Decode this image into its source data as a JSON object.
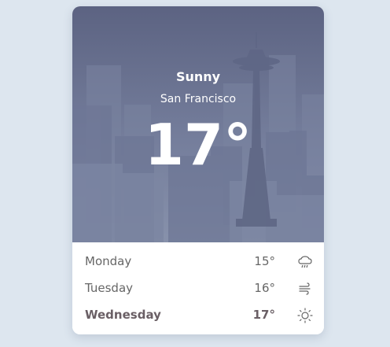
{
  "current": {
    "condition": "Sunny",
    "city": "San Francisco",
    "temperature": "17°"
  },
  "forecast": [
    {
      "day": "Monday",
      "temp": "15°",
      "icon": "rain-cloud-icon"
    },
    {
      "day": "Tuesday",
      "temp": "16°",
      "icon": "wind-icon"
    },
    {
      "day": "Wednesday",
      "temp": "17°",
      "icon": "sun-icon"
    }
  ],
  "colors": {
    "background": "#dde6ef",
    "hero_top": "#5c6382",
    "hero_bottom": "#8791ab"
  }
}
